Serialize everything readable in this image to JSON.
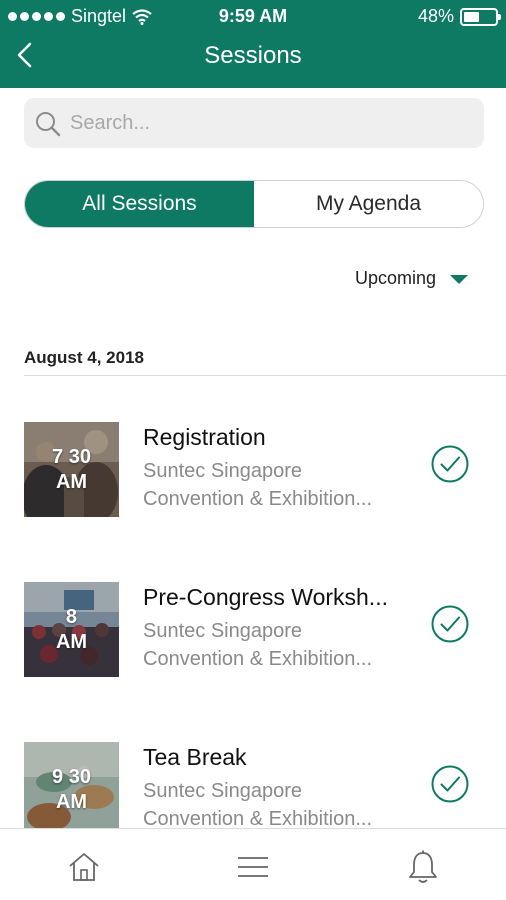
{
  "status_bar": {
    "carrier": "Singtel",
    "time": "9:59 AM",
    "battery": "48%"
  },
  "header": {
    "title": "Sessions"
  },
  "search": {
    "placeholder": "Search..."
  },
  "segments": {
    "all": "All Sessions",
    "agenda": "My Agenda"
  },
  "filter": {
    "label": "Upcoming"
  },
  "date_group": "August 4, 2018",
  "sessions": [
    {
      "time": "7 30\nAM",
      "title": "Registration",
      "location_line1": "Suntec Singapore",
      "location_line2": "Convention & Exhibition..."
    },
    {
      "time": "8\nAM",
      "title": "Pre-Congress Worksh...",
      "location_line1": "Suntec Singapore",
      "location_line2": "Convention & Exhibition..."
    },
    {
      "time": "9 30\nAM",
      "title": "Tea Break",
      "location_line1": "Suntec Singapore",
      "location_line2": "Convention & Exhibition..."
    }
  ],
  "colors": {
    "brand": "#0e7a63",
    "muted_text": "#8a8a8a"
  },
  "tabbar_icons": [
    "home-icon",
    "menu-icon",
    "bell-icon"
  ]
}
